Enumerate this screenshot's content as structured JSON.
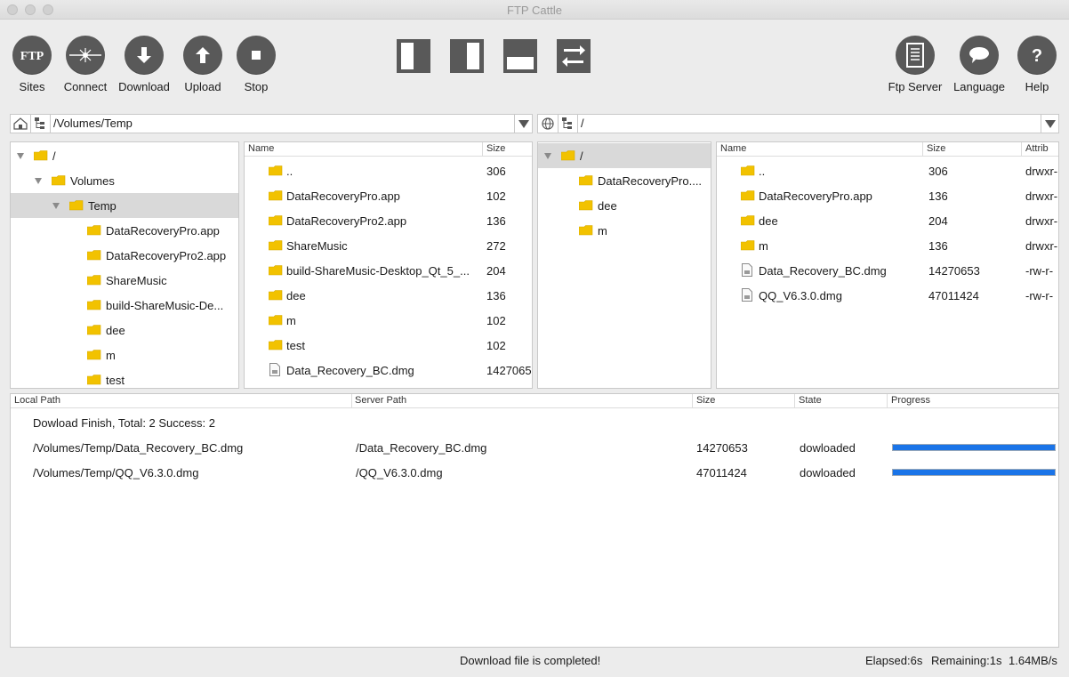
{
  "window": {
    "title": "FTP Cattle"
  },
  "toolbar": {
    "sites": "Sites",
    "connect": "Connect",
    "download": "Download",
    "upload": "Upload",
    "stop": "Stop",
    "ftp_server": "Ftp Server",
    "language": "Language",
    "help": "Help",
    "sites_icon_text": "FTP"
  },
  "local": {
    "path": "/Volumes/Temp",
    "tree": [
      {
        "label": "/"
      },
      {
        "label": "Volumes"
      },
      {
        "label": "Temp"
      },
      {
        "label": "DataRecoveryPro.app"
      },
      {
        "label": "DataRecoveryPro2.app"
      },
      {
        "label": "ShareMusic"
      },
      {
        "label": "build-ShareMusic-De..."
      },
      {
        "label": "dee"
      },
      {
        "label": "m"
      },
      {
        "label": "test"
      }
    ],
    "columns": {
      "name": "Name",
      "size": "Size"
    },
    "files": [
      {
        "name": "..",
        "size": "306"
      },
      {
        "name": "DataRecoveryPro.app",
        "size": "102"
      },
      {
        "name": "DataRecoveryPro2.app",
        "size": "136"
      },
      {
        "name": "ShareMusic",
        "size": "272"
      },
      {
        "name": "build-ShareMusic-Desktop_Qt_5_...",
        "size": "204"
      },
      {
        "name": "dee",
        "size": "136"
      },
      {
        "name": "m",
        "size": "102"
      },
      {
        "name": "test",
        "size": "102"
      },
      {
        "name": "Data_Recovery_BC.dmg",
        "size": "1427065"
      }
    ]
  },
  "remote": {
    "path": "/",
    "tree": [
      {
        "label": "/"
      },
      {
        "label": "DataRecoveryPro...."
      },
      {
        "label": "dee"
      },
      {
        "label": "m"
      }
    ],
    "columns": {
      "name": "Name",
      "size": "Size",
      "attrib": "Attrib"
    },
    "files": [
      {
        "name": "..",
        "size": "306",
        "attrib": "drwxr-"
      },
      {
        "name": "DataRecoveryPro.app",
        "size": "136",
        "attrib": "drwxr-"
      },
      {
        "name": "dee",
        "size": "204",
        "attrib": "drwxr-"
      },
      {
        "name": "m",
        "size": "136",
        "attrib": "drwxr-"
      },
      {
        "name": "Data_Recovery_BC.dmg",
        "size": "14270653",
        "attrib": "-rw-r-"
      },
      {
        "name": "QQ_V6.3.0.dmg",
        "size": "47011424",
        "attrib": "-rw-r-"
      }
    ]
  },
  "transfers": {
    "columns": {
      "local": "Local Path",
      "server": "Server Path",
      "size": "Size",
      "state": "State",
      "progress": "Progress"
    },
    "summary": "Dowload Finish, Total: 2 Success: 2",
    "rows": [
      {
        "local": "/Volumes/Temp/Data_Recovery_BC.dmg",
        "server": "/Data_Recovery_BC.dmg",
        "size": "14270653",
        "state": "dowloaded",
        "progress": 1.0
      },
      {
        "local": "/Volumes/Temp/QQ_V6.3.0.dmg",
        "server": "/QQ_V6.3.0.dmg",
        "size": "47011424",
        "state": "dowloaded",
        "progress": 1.0
      }
    ]
  },
  "status": {
    "message": "Download file is completed!",
    "elapsed": "Elapsed:6s",
    "remaining": "Remaining:1s",
    "speed": "1.64MB/s"
  },
  "colors": {
    "accent": "#1a74e8",
    "button": "#595959",
    "folder": "#f2c200",
    "selection": "#d9d9d9"
  },
  "icons": [
    "ftp-icon",
    "connect-icon",
    "download-icon",
    "upload-icon",
    "stop-icon",
    "ftp-server-icon",
    "language-icon",
    "help-icon",
    "layout-left-icon",
    "layout-right-icon",
    "layout-bottom-icon",
    "swap-icon",
    "home-icon",
    "tree-icon",
    "globe-icon",
    "folder-icon",
    "file-icon"
  ]
}
